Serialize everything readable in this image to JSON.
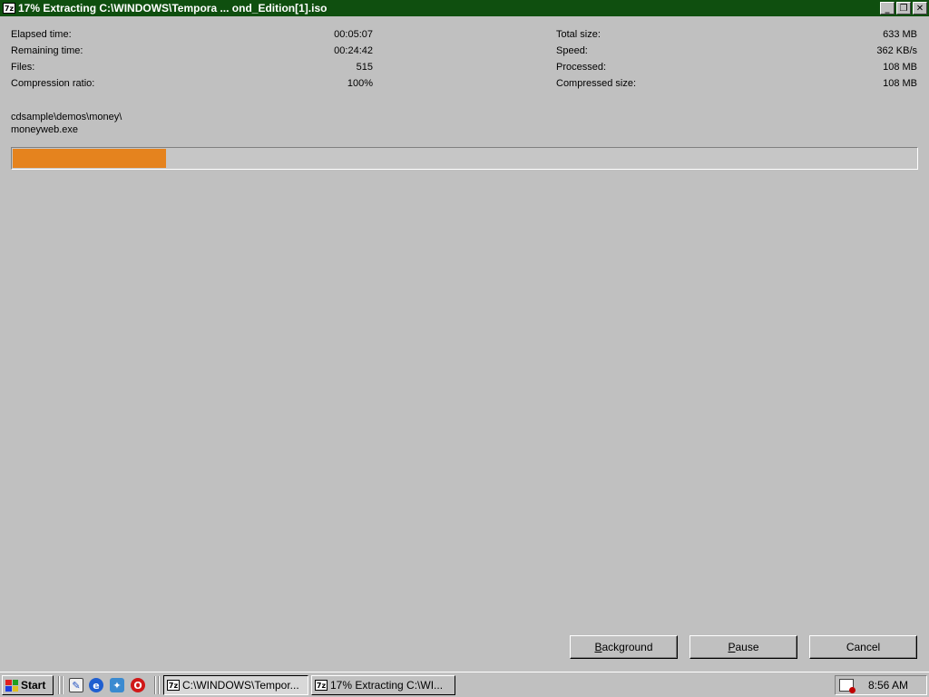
{
  "window": {
    "title": "17% Extracting C:\\WINDOWS\\Tempora ... ond_Edition[1].iso",
    "icon": "7z-icon",
    "title_bar_color": "#0f4f0f"
  },
  "stats_left": [
    {
      "label": "Elapsed time:",
      "value": "00:05:07"
    },
    {
      "label": "Remaining time:",
      "value": "00:24:42"
    },
    {
      "label": "Files:",
      "value": "515"
    },
    {
      "label": "Compression ratio:",
      "value": "100%"
    }
  ],
  "stats_right": [
    {
      "label": "Total size:",
      "value": "633 MB"
    },
    {
      "label": "Speed:",
      "value": "362 KB/s"
    },
    {
      "label": "Processed:",
      "value": "108 MB"
    },
    {
      "label": "Compressed size:",
      "value": "108 MB"
    }
  ],
  "current_file": {
    "path": "cdsample\\demos\\money\\",
    "name": "moneyweb.exe"
  },
  "progress": {
    "fraction": 0.17,
    "fill_color": "#e5831e"
  },
  "buttons": {
    "background": "Background",
    "pause": "Pause",
    "cancel": "Cancel"
  },
  "taskbar": {
    "start_label": "Start",
    "quick_launch": [
      "show-desktop-icon",
      "ie-icon",
      "channels-icon",
      "opera-icon"
    ],
    "tasks": [
      {
        "label": "C:\\WINDOWS\\Tempor...",
        "active": true
      },
      {
        "label": "17% Extracting C:\\WI...",
        "active": false
      }
    ],
    "clock": "8:56 AM"
  }
}
